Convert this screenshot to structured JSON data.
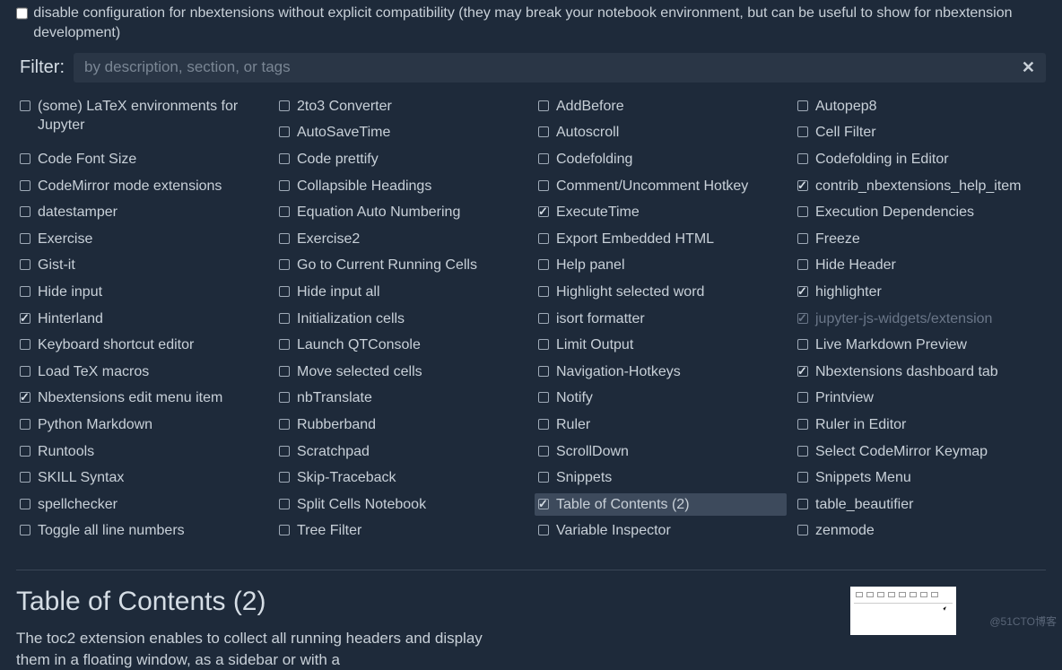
{
  "warning": {
    "text": "disable configuration for nbextensions without explicit compatibility (they may break your notebook environment, but can be useful to show for nbextension development)"
  },
  "filter": {
    "label": "Filter:",
    "placeholder": "by description, section, or tags"
  },
  "extensions": [
    {
      "label": "(some) LaTeX environments for Jupyter",
      "checked": false
    },
    {
      "label": "Code Font Size",
      "checked": false
    },
    {
      "label": "CodeMirror mode extensions",
      "checked": false
    },
    {
      "label": "datestamper",
      "checked": false
    },
    {
      "label": "Exercise",
      "checked": false
    },
    {
      "label": "Gist-it",
      "checked": false
    },
    {
      "label": "Hide input",
      "checked": false
    },
    {
      "label": "Hinterland",
      "checked": true
    },
    {
      "label": "Keyboard shortcut editor",
      "checked": false
    },
    {
      "label": "Load TeX macros",
      "checked": false
    },
    {
      "label": "Nbextensions edit menu item",
      "checked": true
    },
    {
      "label": "Python Markdown",
      "checked": false
    },
    {
      "label": "Runtools",
      "checked": false
    },
    {
      "label": "SKILL Syntax",
      "checked": false
    },
    {
      "label": "spellchecker",
      "checked": false
    },
    {
      "label": "Toggle all line numbers",
      "checked": false
    },
    {
      "label": "2to3 Converter",
      "checked": false
    },
    {
      "label": "AutoSaveTime",
      "checked": false
    },
    {
      "label": "Code prettify",
      "checked": false
    },
    {
      "label": "Collapsible Headings",
      "checked": false
    },
    {
      "label": "Equation Auto Numbering",
      "checked": false
    },
    {
      "label": "Exercise2",
      "checked": false
    },
    {
      "label": "Go to Current Running Cells",
      "checked": false
    },
    {
      "label": "Hide input all",
      "checked": false
    },
    {
      "label": "Initialization cells",
      "checked": false
    },
    {
      "label": "Launch QTConsole",
      "checked": false
    },
    {
      "label": "Move selected cells",
      "checked": false
    },
    {
      "label": "nbTranslate",
      "checked": false
    },
    {
      "label": "Rubberband",
      "checked": false
    },
    {
      "label": "Scratchpad",
      "checked": false
    },
    {
      "label": "Skip-Traceback",
      "checked": false
    },
    {
      "label": "Split Cells Notebook",
      "checked": false
    },
    {
      "label": "Tree Filter",
      "checked": false
    },
    {
      "label": "AddBefore",
      "checked": false
    },
    {
      "label": "Autoscroll",
      "checked": false
    },
    {
      "label": "Codefolding",
      "checked": false
    },
    {
      "label": "Comment/Uncomment Hotkey",
      "checked": false
    },
    {
      "label": "ExecuteTime",
      "checked": true
    },
    {
      "label": "Export Embedded HTML",
      "checked": false
    },
    {
      "label": "Help panel",
      "checked": false
    },
    {
      "label": "Highlight selected word",
      "checked": false
    },
    {
      "label": "isort formatter",
      "checked": false
    },
    {
      "label": "Limit Output",
      "checked": false
    },
    {
      "label": "Navigation-Hotkeys",
      "checked": false
    },
    {
      "label": "Notify",
      "checked": false
    },
    {
      "label": "Ruler",
      "checked": false
    },
    {
      "label": "ScrollDown",
      "checked": false
    },
    {
      "label": "Snippets",
      "checked": false
    },
    {
      "label": "Table of Contents (2)",
      "checked": true,
      "selected": true
    },
    {
      "label": "Variable Inspector",
      "checked": false
    },
    {
      "label": "Autopep8",
      "checked": false
    },
    {
      "label": "Cell Filter",
      "checked": false
    },
    {
      "label": "Codefolding in Editor",
      "checked": false
    },
    {
      "label": "contrib_nbextensions_help_item",
      "checked": true
    },
    {
      "label": "Execution Dependencies",
      "checked": false
    },
    {
      "label": "Freeze",
      "checked": false
    },
    {
      "label": "Hide Header",
      "checked": false
    },
    {
      "label": "highlighter",
      "checked": true
    },
    {
      "label": "jupyter-js-widgets/extension",
      "checked": true,
      "disabled": true
    },
    {
      "label": "Live Markdown Preview",
      "checked": false
    },
    {
      "label": "Nbextensions dashboard tab",
      "checked": true
    },
    {
      "label": "Printview",
      "checked": false
    },
    {
      "label": "Ruler in Editor",
      "checked": false
    },
    {
      "label": "Select CodeMirror Keymap",
      "checked": false
    },
    {
      "label": "Snippets Menu",
      "checked": false
    },
    {
      "label": "table_beautifier",
      "checked": false
    },
    {
      "label": "zenmode",
      "checked": false
    }
  ],
  "detail": {
    "title": "Table of Contents (2)",
    "description": "The toc2 extension enables to collect all running headers and display them in a floating window, as a sidebar or with a"
  },
  "watermark": "@51CTO博客"
}
